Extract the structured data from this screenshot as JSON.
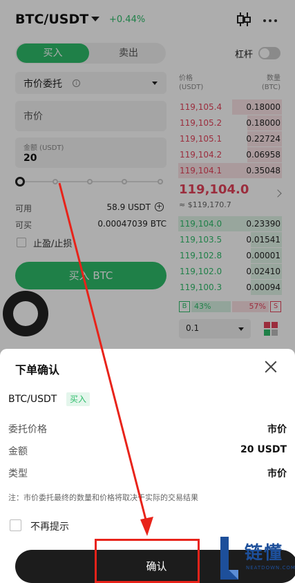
{
  "header": {
    "pair": "BTC/USDT",
    "change": "+0.44%"
  },
  "tabs": {
    "buy": "买入",
    "sell": "卖出"
  },
  "leverage_label": "杠杆",
  "form": {
    "order_type": "市价委托",
    "price_label": "市价",
    "amount_label": "金额 (USDT)",
    "amount_value": "20",
    "slider_percent": 0,
    "available_label": "可用",
    "available_value": "58.9 USDT",
    "buyable_label": "可买",
    "buyable_value": "0.00047039 BTC",
    "tpsl_label": "止盈/止损",
    "buy_button": "买入 BTC"
  },
  "orderbook": {
    "price_header": "价格",
    "price_unit": "(USDT)",
    "qty_header": "数量",
    "qty_unit": "(BTC)",
    "asks": [
      {
        "price": "119,105.4",
        "qty": "0.18000",
        "depth": 0.48
      },
      {
        "price": "119,105.2",
        "qty": "0.18000",
        "depth": 0.33
      },
      {
        "price": "119,105.1",
        "qty": "0.22724",
        "depth": 0.33
      },
      {
        "price": "119,104.2",
        "qty": "0.06958",
        "depth": 0.33
      },
      {
        "price": "119,104.1",
        "qty": "0.35048",
        "depth": 1.0
      }
    ],
    "last_price": "119,104.0",
    "last_fiat": "≈ $119,170.7",
    "bids": [
      {
        "price": "119,104.0",
        "qty": "0.23390",
        "depth": 1.0
      },
      {
        "price": "119,103.5",
        "qty": "0.01541",
        "depth": 0.3
      },
      {
        "price": "119,102.8",
        "qty": "0.00001",
        "depth": 0.3
      },
      {
        "price": "119,102.0",
        "qty": "0.02410",
        "depth": 0.3
      },
      {
        "price": "119,100.3",
        "qty": "0.00094",
        "depth": 0.3
      }
    ],
    "buy_ratio": "43%",
    "sell_ratio": "57%",
    "buy_badge": "B",
    "sell_badge": "S",
    "depth_step": "0.1"
  },
  "sheet": {
    "title": "下单确认",
    "pair": "BTC/USDT",
    "side_badge": "买入",
    "rows": [
      {
        "key": "委托价格",
        "value": "市价"
      },
      {
        "key": "金额",
        "value": "20 USDT"
      },
      {
        "key": "类型",
        "value": "市价"
      }
    ],
    "note": "注：市价委托最终的数量和价格将取决于实际的交易结果",
    "dont_remind": "不再提示",
    "confirm": "确认"
  },
  "watermark": {
    "cn": "链懂",
    "en": "NEATDOWN.COM"
  },
  "colors": {
    "buy": "#2ebd6b",
    "sell": "#e5435b",
    "annotation": "#e8231a",
    "watermark": "#1d4f9a"
  },
  "icons": [
    "dropdown-caret-icon",
    "kline-icon",
    "more-icon",
    "info-icon",
    "plus-circle-icon",
    "chevron-right-icon",
    "layout-icon",
    "close-icon",
    "checkbox-icon"
  ]
}
